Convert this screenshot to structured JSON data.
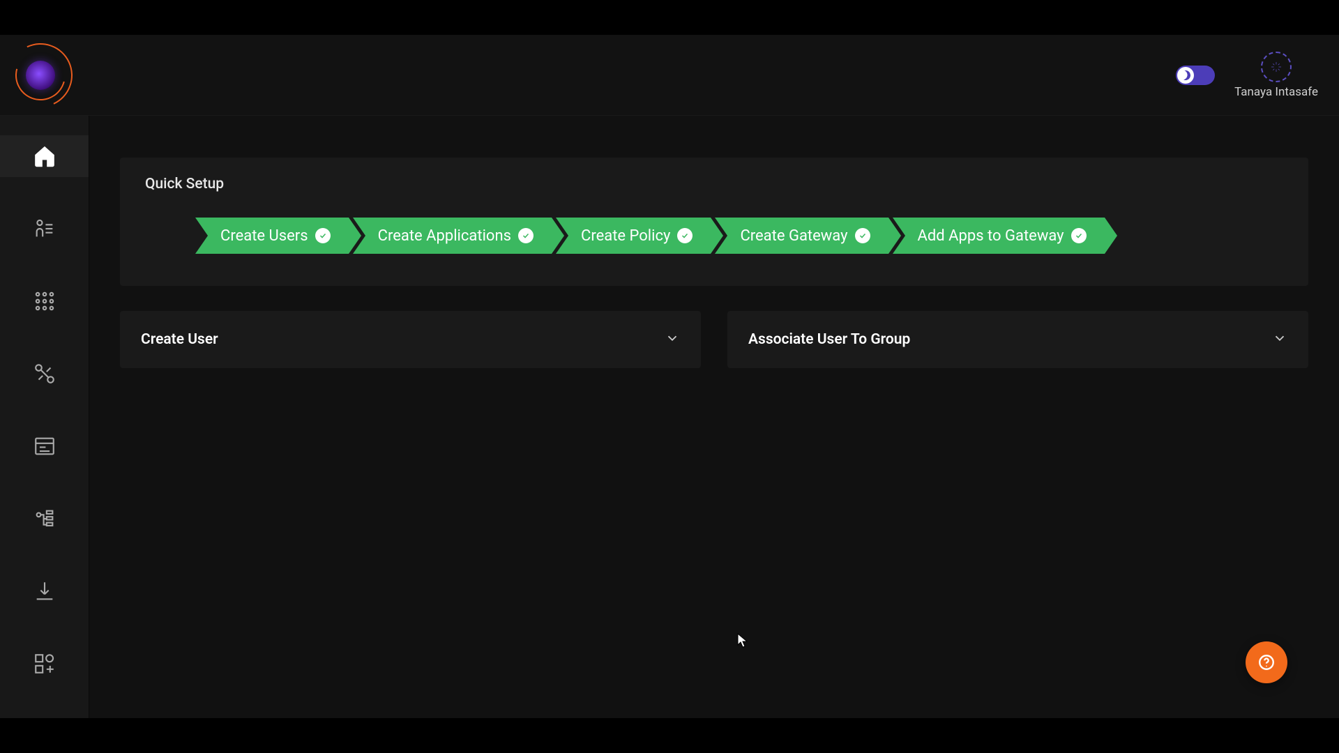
{
  "header": {
    "user_name": "Tanaya Intasafe"
  },
  "sidebar": {
    "items": [
      {
        "name": "home",
        "active": true
      },
      {
        "name": "users",
        "active": false
      },
      {
        "name": "apps-grid",
        "active": false
      },
      {
        "name": "network",
        "active": false
      },
      {
        "name": "logs",
        "active": false
      },
      {
        "name": "settings",
        "active": false
      },
      {
        "name": "download",
        "active": false
      },
      {
        "name": "widgets",
        "active": false
      }
    ]
  },
  "quick_setup": {
    "title": "Quick Setup",
    "steps": [
      {
        "label": "Create Users",
        "done": true
      },
      {
        "label": "Create Applications",
        "done": true
      },
      {
        "label": "Create Policy",
        "done": true
      },
      {
        "label": "Create Gateway",
        "done": true
      },
      {
        "label": "Add Apps to Gateway",
        "done": true
      }
    ]
  },
  "panels": [
    {
      "title": "Create User"
    },
    {
      "title": "Associate User To Group"
    }
  ],
  "colors": {
    "accent_green": "#3bb860",
    "accent_orange": "#f26a1b",
    "accent_purple": "#4c3db8"
  }
}
